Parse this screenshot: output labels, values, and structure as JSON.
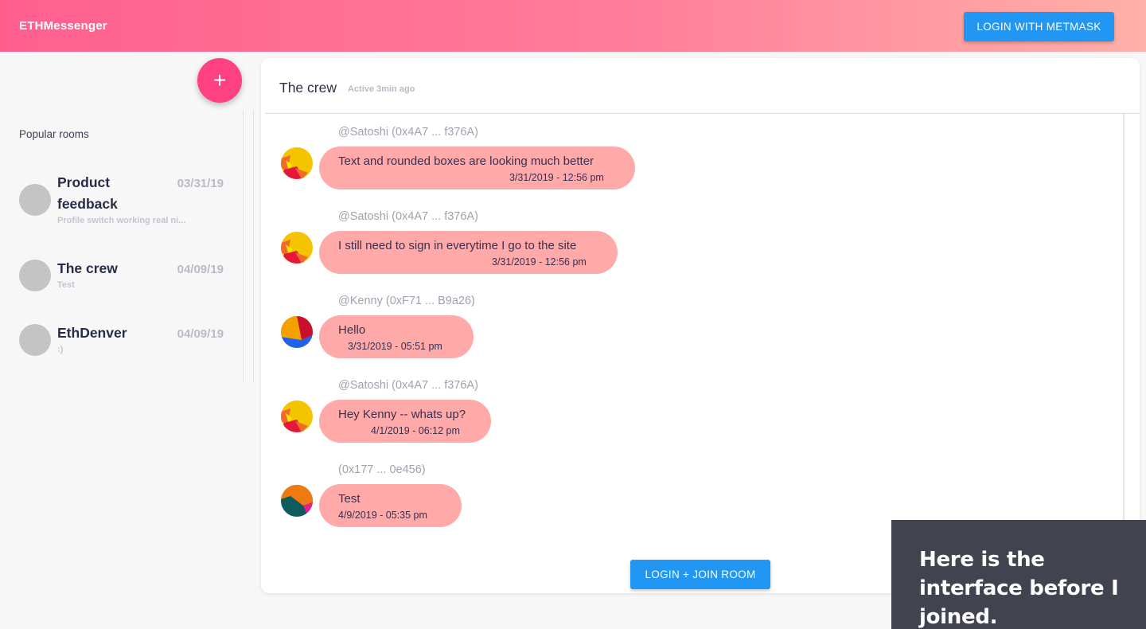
{
  "app": {
    "title": "ETHMessenger",
    "login_label": "LOGIN WITH METMASK"
  },
  "sidebar": {
    "add_icon": "+",
    "popular_label": "Popular rooms",
    "rooms": [
      {
        "name": "Product feedback",
        "date": "03/31/19",
        "preview": "Profile switch working real ni..."
      },
      {
        "name": "The crew",
        "date": "04/09/19",
        "preview": "Test"
      },
      {
        "name": "EthDenver",
        "date": "04/09/19",
        "preview": ":)"
      }
    ]
  },
  "chat": {
    "title": "The crew",
    "status": "Active 3min ago",
    "messages": [
      {
        "author": "@Satoshi (0x4A7 ... f376A)",
        "text": "Text and rounded boxes are looking much better",
        "time": "3/31/2019 - 12:56 pm",
        "avatar": "avatar-satoshi"
      },
      {
        "author": "@Satoshi (0x4A7 ... f376A)",
        "text": "I still need to sign in everytime I go to the site",
        "time": "3/31/2019 - 12:56 pm",
        "avatar": "avatar-satoshi"
      },
      {
        "author": "@Kenny (0xF71 ... B9a26)",
        "text": "Hello",
        "time": "3/31/2019 - 05:51 pm",
        "avatar": "avatar-kenny"
      },
      {
        "author": "@Satoshi (0x4A7 ... f376A)",
        "text": "Hey Kenny -- whats up?",
        "time": "4/1/2019 - 06:12 pm",
        "avatar": "avatar-satoshi"
      },
      {
        "author": "(0x177 ... 0e456)",
        "text": "Test",
        "time": "4/9/2019 - 05:35 pm",
        "avatar": "avatar-anon"
      }
    ],
    "join_label": "LOGIN + JOIN ROOM"
  },
  "caption": {
    "text": "Here is the interface before I joined."
  },
  "colors": {
    "header_gradient_start": "#ff5f8f",
    "header_gradient_end": "#ffb0a8",
    "primary_button": "#2196f3",
    "fab": "#ff4081",
    "bubble": "#ffa9a9"
  }
}
